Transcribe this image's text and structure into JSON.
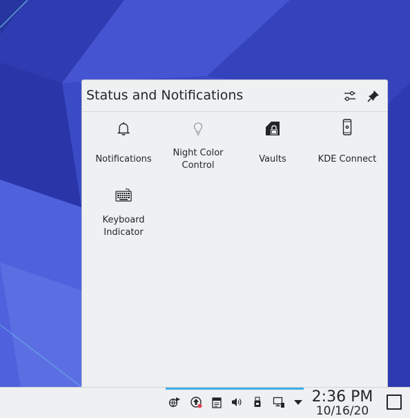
{
  "popup": {
    "title": "Status and Notifications",
    "configure_icon": "configure-icon",
    "pin_icon": "pin-icon",
    "items": [
      {
        "label_lines": [
          "Notifications"
        ],
        "icon": "bell-icon"
      },
      {
        "label_lines": [
          "Night Color",
          "Control"
        ],
        "icon": "lightbulb-icon"
      },
      {
        "label_lines": [
          "Vaults"
        ],
        "icon": "vault-lock-icon"
      },
      {
        "label_lines": [
          "KDE Connect"
        ],
        "icon": "phone-icon"
      },
      {
        "label_lines": [
          "Keyboard",
          "Indicator"
        ],
        "icon": "keyboard-icon"
      }
    ]
  },
  "panel": {
    "tray_icons": [
      "network-share-icon",
      "update-icon",
      "clipboard-icon",
      "volume-icon",
      "usb-device-icon",
      "network-wired-icon",
      "expand-arrow-icon"
    ],
    "clock": {
      "time": "2:36 PM",
      "date": "10/16/20"
    },
    "show_desktop_icon": "show-desktop-icon"
  },
  "colors": {
    "accent": "#3daee9",
    "panel_bg": "#eff0f1",
    "text": "#232627"
  }
}
